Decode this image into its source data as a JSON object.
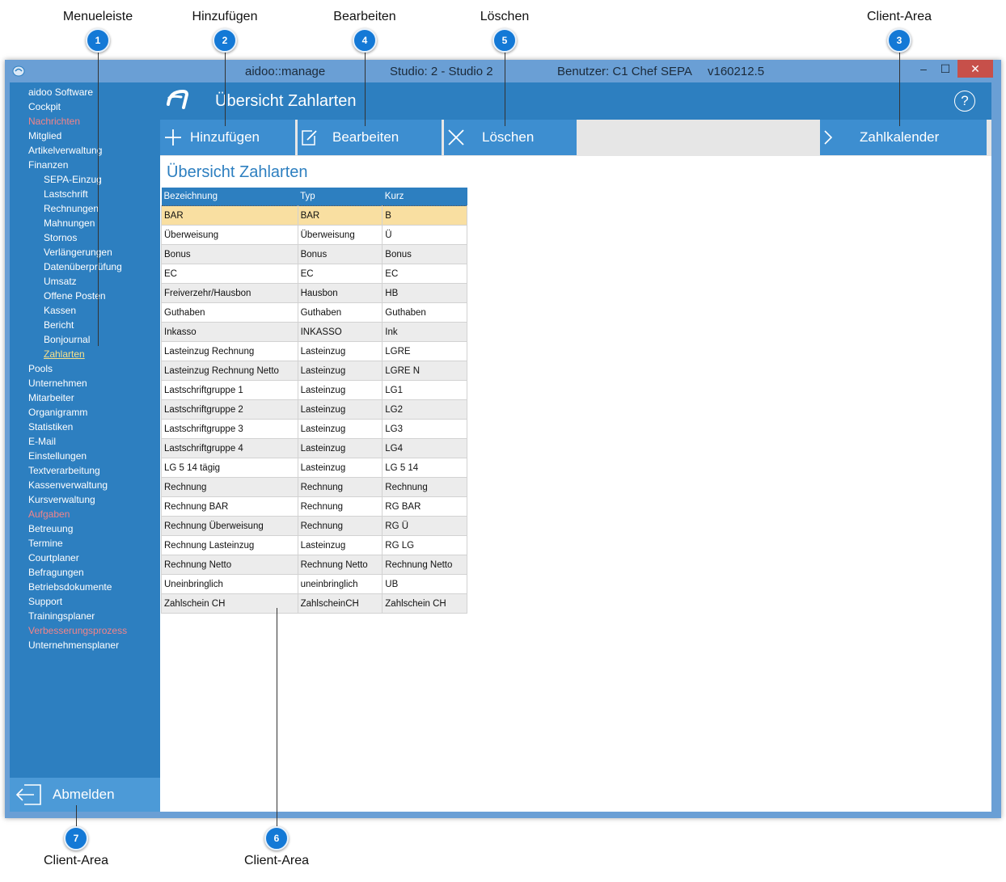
{
  "annotations": [
    {
      "number": "1",
      "label": "Menueleiste"
    },
    {
      "number": "2",
      "label": "Hinzufügen"
    },
    {
      "number": "4",
      "label": "Bearbeiten"
    },
    {
      "number": "5",
      "label": "Löschen"
    },
    {
      "number": "3",
      "label": "Client-Area"
    },
    {
      "number": "7",
      "label": "Client-Area"
    },
    {
      "number": "6",
      "label": "Client-Area"
    }
  ],
  "window": {
    "app_name": "aidoo::manage",
    "studio": "Studio: 2 - Studio 2",
    "user": "Benutzer: C1 Chef",
    "mode": "SEPA",
    "version": "v160212.5",
    "minimize": "–",
    "maximize": "☐",
    "close": "✕"
  },
  "sidebar": {
    "items": [
      {
        "label": "aidoo Software",
        "level": 0
      },
      {
        "label": "Cockpit",
        "level": 0
      },
      {
        "label": "Nachrichten",
        "level": 0,
        "state": "red"
      },
      {
        "label": "Mitglied",
        "level": 0
      },
      {
        "label": "Artikelverwaltung",
        "level": 0
      },
      {
        "label": "Finanzen",
        "level": 0
      },
      {
        "label": "SEPA-Einzug",
        "level": 1
      },
      {
        "label": "Lastschrift",
        "level": 1
      },
      {
        "label": "Rechnungen",
        "level": 1
      },
      {
        "label": "Mahnungen",
        "level": 1
      },
      {
        "label": "Stornos",
        "level": 1
      },
      {
        "label": "Verlängerungen",
        "level": 1
      },
      {
        "label": "Datenüberprüfung",
        "level": 1
      },
      {
        "label": "Umsatz",
        "level": 1
      },
      {
        "label": "Offene Posten",
        "level": 1
      },
      {
        "label": "Kassen",
        "level": 1
      },
      {
        "label": "Bericht",
        "level": 1
      },
      {
        "label": "Bonjournal",
        "level": 1
      },
      {
        "label": "Zahlarten",
        "level": 1,
        "state": "active"
      },
      {
        "label": "Pools",
        "level": 0
      },
      {
        "label": "Unternehmen",
        "level": 0
      },
      {
        "label": "Mitarbeiter",
        "level": 0
      },
      {
        "label": "Organigramm",
        "level": 0
      },
      {
        "label": "Statistiken",
        "level": 0
      },
      {
        "label": "E-Mail",
        "level": 0
      },
      {
        "label": "Einstellungen",
        "level": 0
      },
      {
        "label": "Textverarbeitung",
        "level": 0
      },
      {
        "label": "Kassenverwaltung",
        "level": 0
      },
      {
        "label": "Kursverwaltung",
        "level": 0
      },
      {
        "label": "Aufgaben",
        "level": 0,
        "state": "red"
      },
      {
        "label": "Betreuung",
        "level": 0
      },
      {
        "label": "Termine",
        "level": 0
      },
      {
        "label": "Courtplaner",
        "level": 0
      },
      {
        "label": "Befragungen",
        "level": 0
      },
      {
        "label": "Betriebsdokumente",
        "level": 0
      },
      {
        "label": "Support",
        "level": 0
      },
      {
        "label": "Trainingsplaner",
        "level": 0
      },
      {
        "label": "Verbesserungsprozess",
        "level": 0,
        "state": "red"
      },
      {
        "label": "Unternehmensplaner",
        "level": 0
      }
    ],
    "logout_label": "Abmelden"
  },
  "header": {
    "title": "Übersicht Zahlarten",
    "help": "?"
  },
  "toolbar": {
    "add_label": "Hinzufügen",
    "edit_label": "Bearbeiten",
    "delete_label": "Löschen",
    "calendar_label": "Zahlkalender"
  },
  "content": {
    "title": "Übersicht Zahlarten",
    "columns": [
      "Bezeichnung",
      "Typ",
      "Kurz"
    ],
    "rows": [
      [
        "BAR",
        "BAR",
        "B"
      ],
      [
        "Überweisung",
        "Überweisung",
        "Ü"
      ],
      [
        "Bonus",
        "Bonus",
        "Bonus"
      ],
      [
        "EC",
        "EC",
        "EC"
      ],
      [
        "Freiverzehr/Hausbon",
        "Hausbon",
        "HB"
      ],
      [
        "Guthaben",
        "Guthaben",
        "Guthaben"
      ],
      [
        "Inkasso",
        "INKASSO",
        "Ink"
      ],
      [
        "Lasteinzug Rechnung",
        "Lasteinzug",
        "LGRE"
      ],
      [
        "Lasteinzug Rechnung Netto",
        "Lasteinzug",
        "LGRE N"
      ],
      [
        "Lastschriftgruppe 1",
        "Lasteinzug",
        "LG1"
      ],
      [
        "Lastschriftgruppe 2",
        "Lasteinzug",
        "LG2"
      ],
      [
        "Lastschriftgruppe 3",
        "Lasteinzug",
        "LG3"
      ],
      [
        "Lastschriftgruppe 4",
        "Lasteinzug",
        "LG4"
      ],
      [
        "LG 5 14 tägig",
        "Lasteinzug",
        "LG 5 14"
      ],
      [
        "Rechnung",
        "Rechnung",
        "Rechnung"
      ],
      [
        "Rechnung BAR",
        "Rechnung",
        "RG BAR"
      ],
      [
        "Rechnung Überweisung",
        "Rechnung",
        "RG Ü"
      ],
      [
        "Rechnung Lasteinzug",
        "Lasteinzug",
        "RG LG"
      ],
      [
        "Rechnung Netto",
        "Rechnung Netto",
        "Rechnung Netto"
      ],
      [
        "Uneinbringlich",
        "uneinbringlich",
        "UB"
      ],
      [
        "Zahlschein CH",
        "ZahlscheinCH",
        "Zahlschein CH"
      ]
    ],
    "selected_row": 0
  },
  "colors": {
    "accent": "#2d7fc0",
    "toolbar_button": "#3d8ed0",
    "titlebar": "#6a9fd5",
    "selected_row": "#f9dfa1",
    "badge": "#1479d6"
  }
}
